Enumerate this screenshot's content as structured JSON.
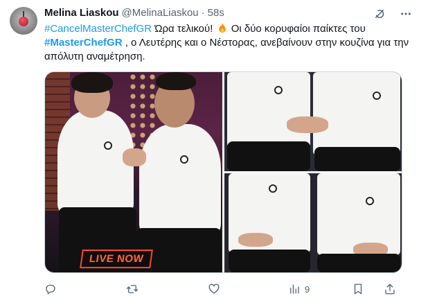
{
  "author": {
    "name": "Melina Liaskou",
    "handle": "@MelinaLiaskou",
    "separator": "·",
    "time": "58s"
  },
  "tweet": {
    "hashtag1": "#CancelMasterChefGR",
    "text1": " Ώρα τελικού! ",
    "text2": " Οι δύο κορυφαίοι παίκτες του ",
    "hashtag2": "#MasterChefGR",
    "text3": " , ο Λευτέρης και ο Νέστορας, ανεβαίνουν στην κουζίνα για την απόλυτη αναμέτρηση."
  },
  "media": {
    "badge": "LIVE NOW"
  },
  "actions": {
    "reply_count": "",
    "retweet_count": "",
    "like_count": "",
    "views_count": "9"
  },
  "icons": [
    "grok-icon",
    "more-icon",
    "reply-icon",
    "retweet-icon",
    "like-icon",
    "views-icon",
    "bookmark-icon",
    "share-icon"
  ],
  "colors": {
    "link": "#1d9bf0",
    "muted": "#536471",
    "live_badge": "#ff4a2a"
  }
}
